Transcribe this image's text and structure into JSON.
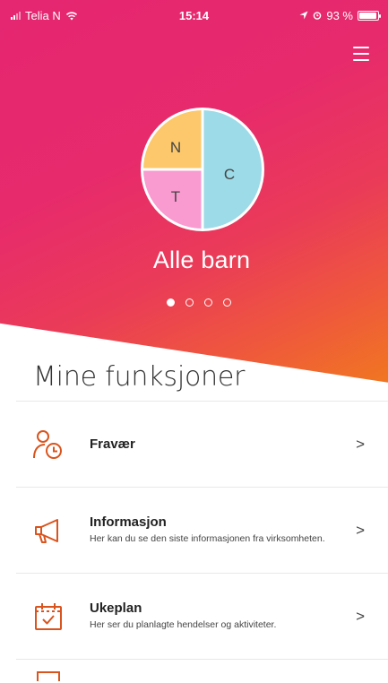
{
  "status_bar": {
    "carrier": "Telia N",
    "time": "15:14",
    "battery": "93 %",
    "battery_level": 0.93
  },
  "colors": {
    "hero_start": "#e52671",
    "hero_end": "#f07a1e",
    "pie_yellow": "#fcc86b",
    "pie_blue": "#9ddbe8",
    "pie_pink": "#f99ad0",
    "icon_orange": "#d9541e"
  },
  "hero": {
    "menu_icon": "hamburger-menu-icon",
    "pie_labels": {
      "n": "N",
      "c": "C",
      "t": "T"
    },
    "title": "Alle barn",
    "page_count": 4,
    "active_page": 1
  },
  "section": {
    "title": "Mine funksjoner"
  },
  "features": [
    {
      "title": "Fravær",
      "subtitle": "",
      "icon": "person-clock-icon"
    },
    {
      "title": "Informasjon",
      "subtitle": "Her kan du se den siste informasjonen fra virksomheten.",
      "icon": "megaphone-icon"
    },
    {
      "title": "Ukeplan",
      "subtitle": "Her ser du planlagte hendelser og aktiviteter.",
      "icon": "calendar-check-icon"
    },
    {
      "title": "",
      "subtitle": "",
      "icon": "partial-icon"
    }
  ],
  "chevron": ">"
}
